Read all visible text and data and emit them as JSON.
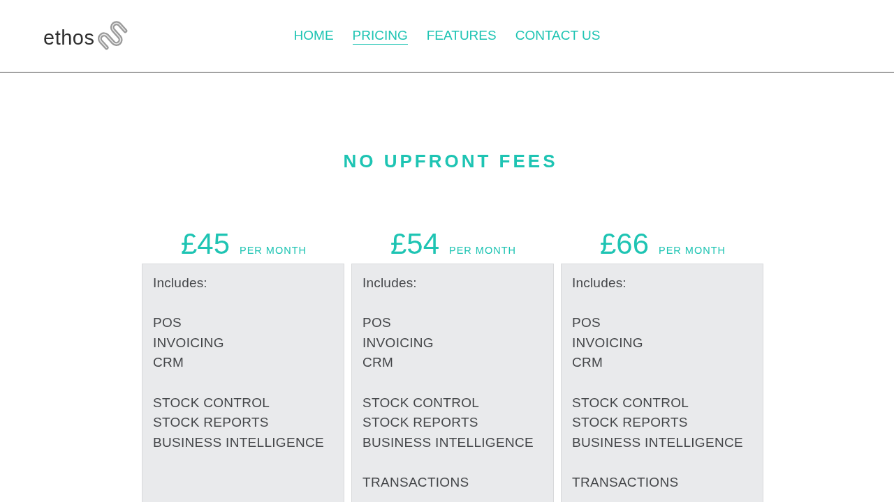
{
  "header": {
    "logo": {
      "text": "ethos"
    },
    "nav": [
      {
        "label": "HOME",
        "selected": false
      },
      {
        "label": "PRICING",
        "selected": true
      },
      {
        "label": "FEATURES",
        "selected": false
      },
      {
        "label": "CONTACT US",
        "selected": false
      }
    ]
  },
  "heading": "NO UPFRONT FEES",
  "plans": [
    {
      "price": "£45",
      "period": "PER MONTH",
      "intro": "Includes:",
      "groups": [
        {
          "features": [
            "POS",
            "INVOICING",
            "CRM"
          ]
        },
        {
          "features": [
            "STOCK CONTROL",
            "STOCK REPORTS",
            "BUSINESS INTELLIGENCE"
          ]
        }
      ]
    },
    {
      "price": "£54",
      "period": "PER MONTH",
      "intro": "Includes:",
      "groups": [
        {
          "features": [
            "POS",
            "INVOICING",
            "CRM"
          ]
        },
        {
          "features": [
            "STOCK CONTROL",
            "STOCK REPORTS",
            "BUSINESS INTELLIGENCE"
          ]
        },
        {
          "features": [
            "TRANSACTIONS"
          ]
        }
      ]
    },
    {
      "price": "£66",
      "period": "PER MONTH",
      "intro": "Includes:",
      "groups": [
        {
          "features": [
            "POS",
            "INVOICING",
            "CRM"
          ]
        },
        {
          "features": [
            "STOCK CONTROL",
            "STOCK REPORTS",
            "BUSINESS INTELLIGENCE"
          ]
        },
        {
          "features": [
            "TRANSACTIONS"
          ]
        }
      ]
    }
  ]
}
